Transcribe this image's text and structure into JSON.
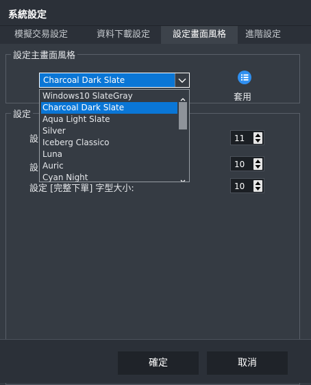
{
  "window": {
    "title": "系統設定"
  },
  "tabs": [
    {
      "label": "模擬交易設定"
    },
    {
      "label": "資料下載設定"
    },
    {
      "label": "設定畫面風格"
    },
    {
      "label": "進階設定"
    }
  ],
  "theme_group": {
    "label": "設定主畫面風格",
    "selected": "Charcoal Dark Slate",
    "apply_label": "套用",
    "options": [
      "Windows10 SlateGray",
      "Charcoal Dark Slate",
      "Aqua Light Slate",
      "Silver",
      "Iceberg Classico",
      "Luna",
      "Auric",
      "Cyan Night"
    ]
  },
  "font_group": {
    "label": "設定",
    "row1_label": "設",
    "row1_value": "11",
    "row2_label": "設",
    "row2_value": "10",
    "row3_label": "設定 [完整下單] 字型大小:",
    "row3_value": "10"
  },
  "footer": {
    "ok_label": "確定",
    "cancel_label": "取消"
  },
  "colors": {
    "accent": "#0a76d6",
    "background": "#353b43",
    "titlebar": "#2b3038"
  },
  "icons": {
    "apply": "list-circle-icon",
    "dropdown_arrow": "chevron-down-icon"
  }
}
